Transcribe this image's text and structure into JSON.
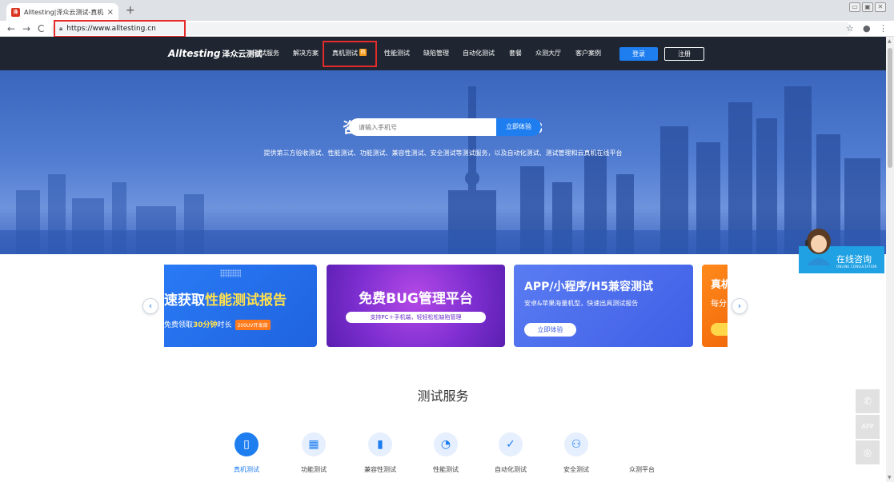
{
  "browser": {
    "tab_favicon": "泽",
    "tab_title": "Alltesting|泽众云测试-真机-兼容",
    "tab_close": "×",
    "new_tab": "+",
    "back": "←",
    "forward": "→",
    "reload": "C",
    "url": "https://www.alltesting.cn",
    "star": "☆",
    "account": "●",
    "menu": "⋮",
    "window_controls": [
      "▭",
      "▣",
      "✕"
    ]
  },
  "nav": {
    "logo_text": "Alltesting",
    "logo_cn": "泽众云测试",
    "items": [
      "测试服务",
      "解决方案",
      "真机测试",
      "性能测试",
      "缺陷管理",
      "自动化测试",
      "套餐",
      "众测大厅",
      "客户案例"
    ],
    "hot_badge": "热",
    "login": "登录",
    "register": "注册"
  },
  "hero": {
    "title": "咨询热线：021-6072 5088",
    "subtitle": "提供第三方验收测试、性能测试、功能测试、兼容性测试、安全测试等测试服务，以及自动化测试、测试管理和云真机在线平台",
    "phone_placeholder": "请输入手机号",
    "try_button": "立即体验"
  },
  "consult": {
    "label": "在线咨询",
    "label_en": "ONLINE CONSULTATION"
  },
  "carousel": {
    "prev": "‹",
    "next": "›",
    "card1": {
      "title_a": "速获取",
      "title_b": "性能测试报告",
      "sub_a": "免费领取",
      "sub_b": "30分钟",
      "sub_c": "时长",
      "badge": "200UV开发部"
    },
    "card2": {
      "title": "免费BUG管理平台",
      "pill": "支持PC＋手机端，轻轻松松缺陷管理"
    },
    "card3": {
      "title": "APP/小程序/H5兼容测试",
      "sub": "安卓&苹果海量机型，快速出具测试报告",
      "button": "立即体验"
    },
    "card4": {
      "title": "真机",
      "sub": "每分"
    }
  },
  "services": {
    "title": "测试服务",
    "items": [
      {
        "label": "真机测试",
        "icon": "phone-icon",
        "glyph": "▯"
      },
      {
        "label": "功能测试",
        "icon": "function-icon",
        "glyph": "▦"
      },
      {
        "label": "兼容性测试",
        "icon": "compat-icon",
        "glyph": "▮"
      },
      {
        "label": "性能测试",
        "icon": "gauge-icon",
        "glyph": "◔"
      },
      {
        "label": "自动化测试",
        "icon": "shield-icon",
        "glyph": "✓"
      },
      {
        "label": "安全测试",
        "icon": "users-icon",
        "glyph": "⚇"
      },
      {
        "label": "众测平台",
        "icon": "crowd-icon",
        "glyph": ""
      }
    ]
  },
  "tools": {
    "phone": "✆",
    "app": "APP",
    "wechat": "◎"
  }
}
